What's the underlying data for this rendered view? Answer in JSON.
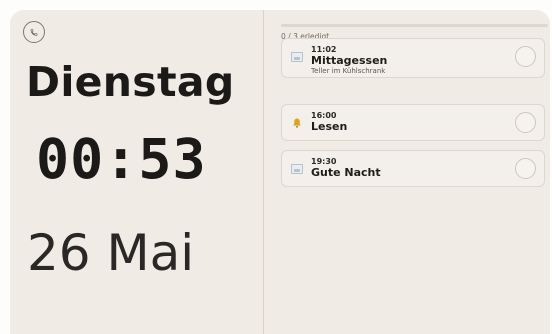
{
  "clock": {
    "day": "Dienstag",
    "time": "00:53",
    "date": "26 Mai"
  },
  "phone_button": {
    "icon": "phone-icon"
  },
  "progress": {
    "text": "0 / 3 erledigt",
    "fraction": 0.0
  },
  "tasks": [
    {
      "time": "11:02",
      "title": "Mittagessen",
      "subtitle": "Teller im Kühlschrank",
      "icon": "image-icon"
    },
    {
      "time": "16:00",
      "title": "Lesen",
      "subtitle": "",
      "icon": "bell-icon"
    },
    {
      "time": "19:30",
      "title": "Gute Nacht",
      "subtitle": "",
      "icon": "image-icon"
    }
  ],
  "colors": {
    "panel": "#f0ebe4",
    "bell": "#e0a21a"
  }
}
